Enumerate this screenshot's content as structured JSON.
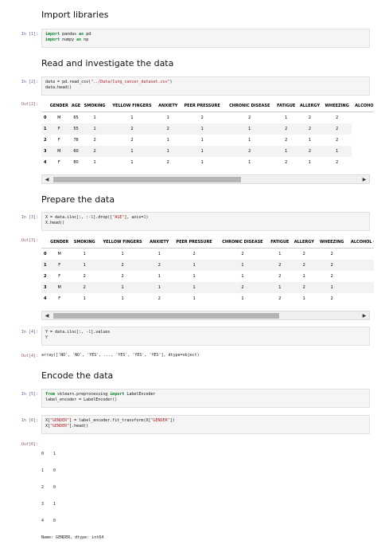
{
  "sections": {
    "import": "Import libraries",
    "read": "Read and investigate the data",
    "prepare": "Prepare the data",
    "encode": "Encode the data"
  },
  "prompts": {
    "in1": "In [1]:",
    "in2": "In [2]:",
    "out2": "Out[2]:",
    "in3": "In [3]:",
    "out3": "Out[3]:",
    "in4": "In [4]:",
    "out4": "Out[4]:",
    "in5": "In [5]:",
    "in6": "In [6]:",
    "out6": "Out[6]:"
  },
  "code": {
    "in1": [
      "import pandas as pd",
      "import numpy as np"
    ],
    "in2": [
      "data = pd.read_csv(\"../Data/lung_cancer_dataset.csv\")",
      "data.head()"
    ],
    "in3": [
      "X = data.iloc[:, :-1].drop([\"AGE\"], axis=1)",
      "X.head()"
    ],
    "in4": [
      "Y = data.iloc[:, -1].values",
      "Y"
    ],
    "in5": [
      "from sklearn.preprocessing import LabelEncoder",
      "label_encoder = LabelEncoder()"
    ],
    "in6": [
      "X[\"GENDER\"] = label_encoder.fit_transform(X[\"GENDER\"])",
      "X[\"GENDER\"].head()"
    ]
  },
  "table1": {
    "columns": [
      "",
      "GENDER",
      "AGE",
      "SMOKING",
      "YELLOW FINGERS",
      "ANXIETY",
      "PEER PRESSURE",
      "CHRONIC DISEASE",
      "FATIGUE",
      "ALLERGY",
      "WHEEZING",
      "ALCOHOL C"
    ],
    "rows": [
      [
        "0",
        "M",
        "65",
        "1",
        "1",
        "1",
        "2",
        "2",
        "1",
        "2",
        "2"
      ],
      [
        "1",
        "F",
        "55",
        "1",
        "2",
        "2",
        "1",
        "1",
        "2",
        "2",
        "2"
      ],
      [
        "2",
        "F",
        "78",
        "2",
        "2",
        "1",
        "1",
        "1",
        "2",
        "1",
        "2"
      ],
      [
        "3",
        "M",
        "60",
        "2",
        "1",
        "1",
        "1",
        "2",
        "1",
        "2",
        "1"
      ],
      [
        "4",
        "F",
        "80",
        "1",
        "1",
        "2",
        "1",
        "1",
        "2",
        "1",
        "2"
      ]
    ]
  },
  "table2": {
    "columns": [
      "",
      "GENDER",
      "SMOKING",
      "YELLOW FINGERS",
      "ANXIETY",
      "PEER PRESSURE",
      "CHRONIC DISEASE",
      "FATIGUE",
      "ALLERGY",
      "WHEEZING",
      "ALCOHOL CO"
    ],
    "rows": [
      [
        "0",
        "M",
        "1",
        "1",
        "1",
        "2",
        "2",
        "1",
        "2",
        "2",
        ""
      ],
      [
        "1",
        "F",
        "1",
        "2",
        "2",
        "1",
        "1",
        "2",
        "2",
        "2",
        ""
      ],
      [
        "2",
        "F",
        "2",
        "2",
        "1",
        "1",
        "1",
        "2",
        "1",
        "2",
        ""
      ],
      [
        "3",
        "M",
        "2",
        "1",
        "1",
        "1",
        "2",
        "1",
        "2",
        "1",
        ""
      ],
      [
        "4",
        "F",
        "1",
        "1",
        "2",
        "1",
        "1",
        "2",
        "1",
        "2",
        ""
      ]
    ]
  },
  "out4": "array(['NO', 'NO', 'YES', ..., 'YES', 'YES', 'YES'], dtype=object)",
  "out6": [
    "0    1",
    "1    0",
    "2    0",
    "3    1",
    "4    0",
    "Name: GENDER, dtype: int64"
  ],
  "icons": {
    "left": "triangle-left-icon",
    "right": "triangle-right-icon"
  }
}
